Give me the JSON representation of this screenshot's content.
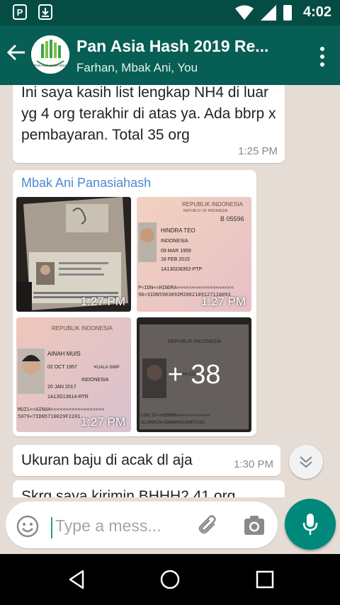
{
  "status_bar": {
    "time": "4:02"
  },
  "header": {
    "title": "Pan Asia Hash 2019 Re...",
    "subtitle": "Farhan, Mbak Ani, You",
    "avatar_caption": "PAN ASIA HASH 2019"
  },
  "messages": [
    {
      "text": "Ini saya kasih list lengkap NH4 di luar yg 4 org terakhir di atas ya. Ada bbrp x pembayaran. Total 35 org",
      "time": "1:25 PM"
    },
    {
      "sender": "Mbak Ani Panasiahash",
      "photos": [
        {
          "time": "1:27 PM",
          "alt": "Passport photo page"
        },
        {
          "time": "1:27 PM",
          "alt": "Passport Republik Indonesia - Hindra Teo"
        },
        {
          "time": "1:27 PM",
          "alt": "Passport Republik Indonesia - Ainah Muis"
        },
        {
          "more": "+ 38",
          "alt": "Passport Republik Indonesia"
        }
      ],
      "passport": {
        "header": "REPUBLIK INDONESIA",
        "sub": "REPUBLIC OF INDONESIA",
        "p2_name": "HINDRA TEO",
        "p2_nat": "INDONESIA",
        "p2_dob": "09 MAR 1959",
        "p2_issue": "18 FEB 2015",
        "p2_no": "B 05596",
        "p2_code": "1A13GD8352-PTP",
        "p2_mrz1": "P<IDN<<HINDRA<<<<<<<<<<<<<<<<<<<",
        "p2_mrz2": "96<3IDN5903092M2002189127110093",
        "p3_name": "AINAH MUIS",
        "p3_nat": "INDONESIA",
        "p3_dob": "02 OCT 1957",
        "p3_issue": "20 JAN 2017",
        "p3_code": "1A13G13614-RTR",
        "p3_place": "KUALA SIMP",
        "p3_mrz1": "MUIS<<AINAH<<<<<<<<<<<<<<<<<<",
        "p3_mrz2": "5079<7IDN5710029F2201...",
        "p4_name": "HERMAN COR",
        "p4_mrz1": "CORLIE<<HERMAN<<<<<<<<<<<<<",
        "p4_mrz2": "ALSHERIN<IDN600916ANF2201"
      }
    },
    {
      "text": "Ukuran baju di acak dl aja",
      "time": "1:30 PM"
    },
    {
      "text": "Skrg saya kirimin BHHH2 41 org"
    }
  ],
  "input": {
    "placeholder": "Type a mess..."
  }
}
